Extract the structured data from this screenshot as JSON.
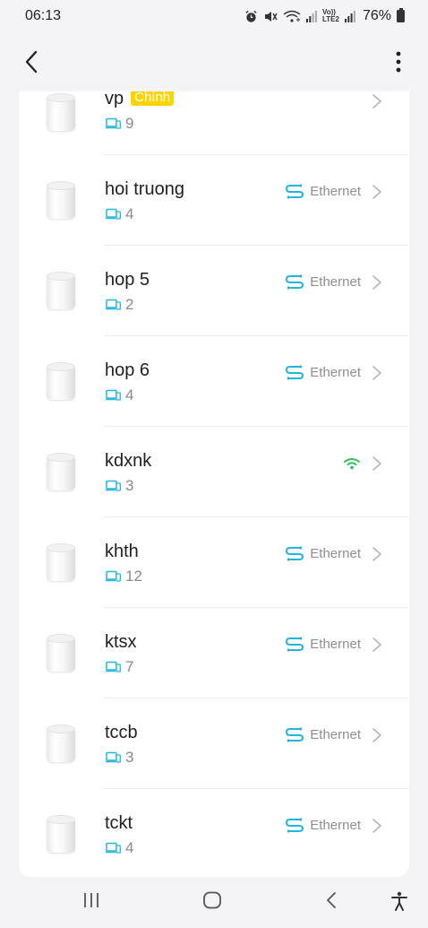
{
  "status_bar": {
    "time": "06:13",
    "network_label_top": "Vo))",
    "network_label_bottom": "LTE2",
    "battery": "76%",
    "icons": [
      "alarm-icon",
      "mute-icon",
      "wifi-call-icon",
      "signal-icon",
      "signal-icon",
      "battery-icon"
    ]
  },
  "top_bar": {
    "back_icon": "chevron-left-icon",
    "more_icon": "more-vertical-icon"
  },
  "colors": {
    "accent": "#1fb6e0",
    "wifi_green": "#2ec15a",
    "badge_yellow": "#ffd400"
  },
  "nodes": [
    {
      "name": "vp",
      "badge": "Chính",
      "clients": "9",
      "connection": "",
      "connection_icon": ""
    },
    {
      "name": "hoi truong",
      "badge": "",
      "clients": "4",
      "connection": "Ethernet",
      "connection_icon": "ethernet-icon"
    },
    {
      "name": "hop 5",
      "badge": "",
      "clients": "2",
      "connection": "Ethernet",
      "connection_icon": "ethernet-icon"
    },
    {
      "name": "hop 6",
      "badge": "",
      "clients": "4",
      "connection": "Ethernet",
      "connection_icon": "ethernet-icon"
    },
    {
      "name": "kdxnk",
      "badge": "",
      "clients": "3",
      "connection": "",
      "connection_icon": "wifi-icon"
    },
    {
      "name": "khth",
      "badge": "",
      "clients": "12",
      "connection": "Ethernet",
      "connection_icon": "ethernet-icon"
    },
    {
      "name": "ktsx",
      "badge": "",
      "clients": "7",
      "connection": "Ethernet",
      "connection_icon": "ethernet-icon"
    },
    {
      "name": "tccb",
      "badge": "",
      "clients": "3",
      "connection": "Ethernet",
      "connection_icon": "ethernet-icon"
    },
    {
      "name": "tckt",
      "badge": "",
      "clients": "4",
      "connection": "Ethernet",
      "connection_icon": "ethernet-icon"
    }
  ],
  "nav_bar": {
    "icons": [
      "recents-icon",
      "home-icon",
      "back-icon",
      "accessibility-icon"
    ]
  }
}
